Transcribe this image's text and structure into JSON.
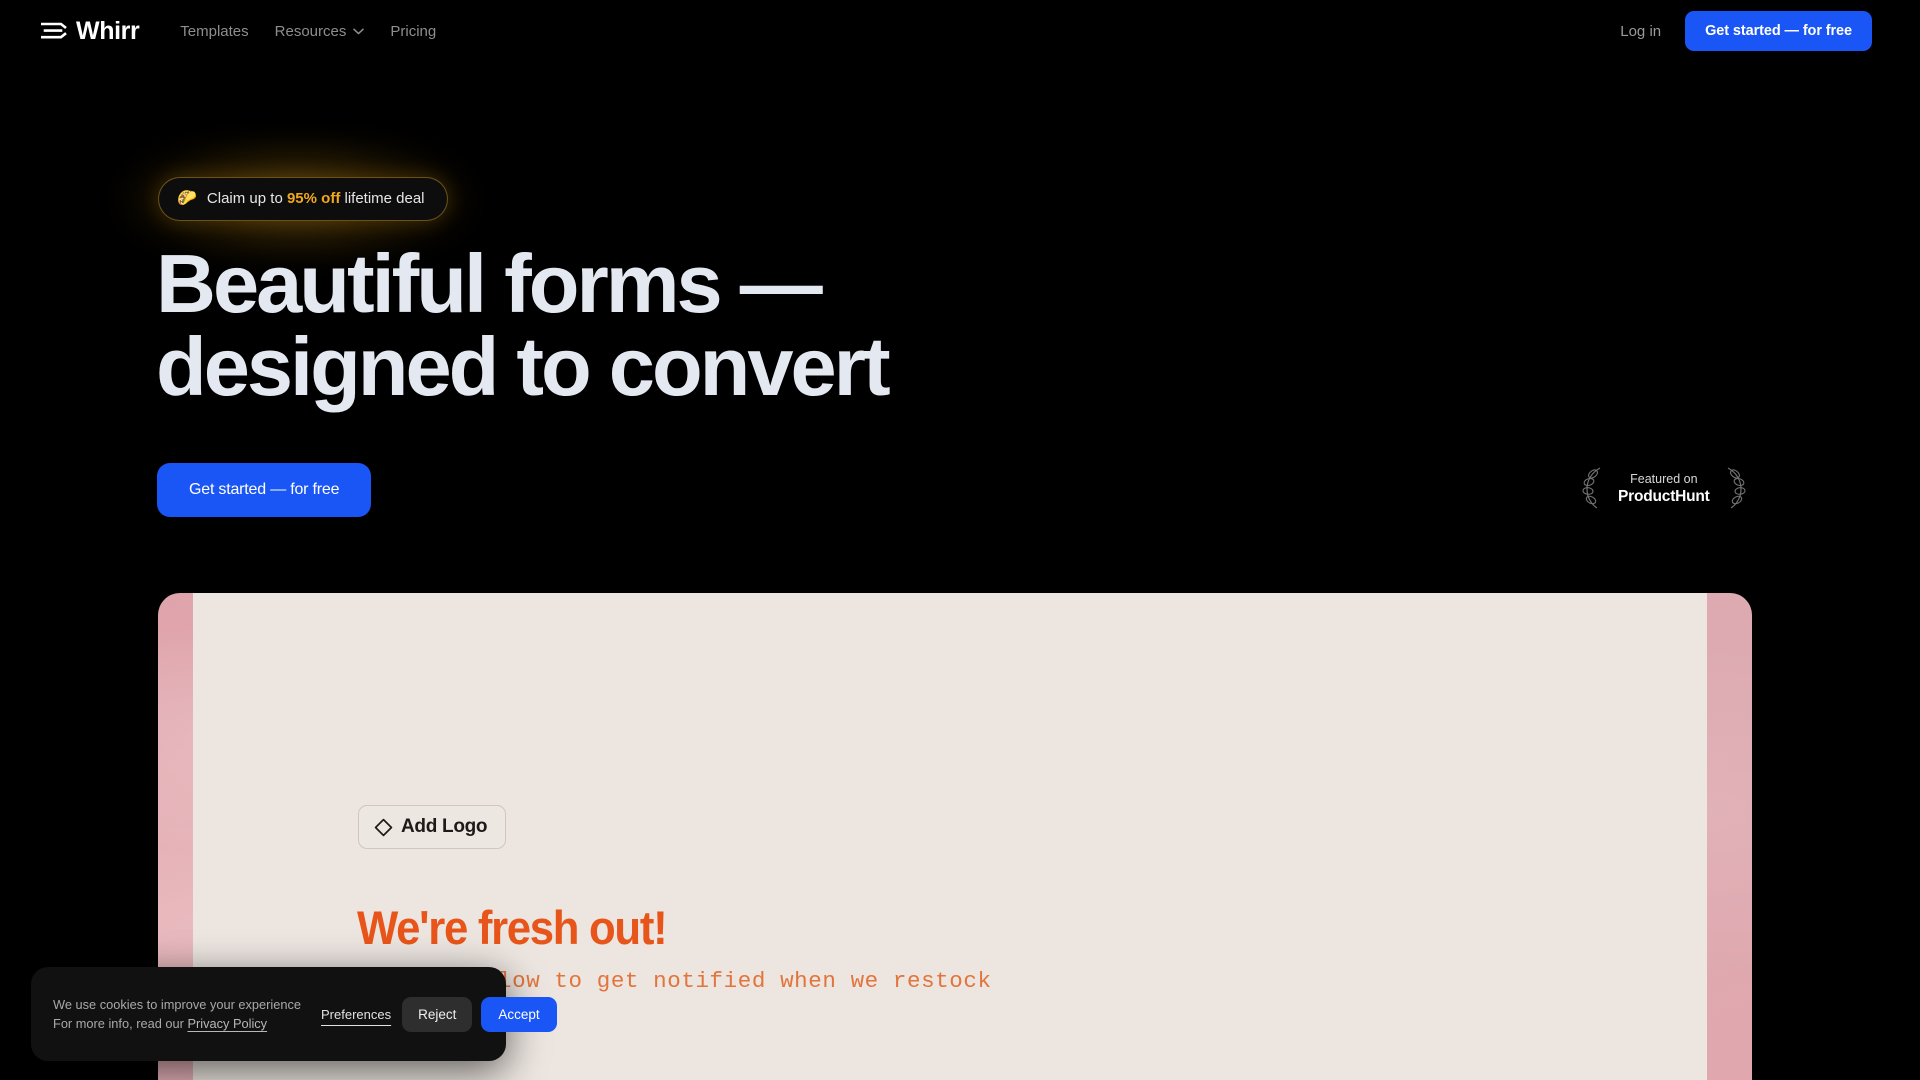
{
  "brand": {
    "name": "Whirr",
    "logo_icon": "whirr-wave-mark"
  },
  "nav": {
    "links": [
      {
        "label": "Templates",
        "has_dropdown": false
      },
      {
        "label": "Resources",
        "has_dropdown": true
      },
      {
        "label": "Pricing",
        "has_dropdown": false
      }
    ],
    "login_label": "Log in",
    "cta_label": "Get started — for free"
  },
  "hero": {
    "promo": {
      "emoji": "🌮",
      "text_before": "Claim up to ",
      "accent": "95% off",
      "text_after": " lifetime deal"
    },
    "headline": "Beautiful forms —\ndesigned to convert",
    "cta_label": "Get started — for free",
    "producthunt": {
      "featured_label": "Featured on",
      "name": "ProductHunt",
      "left_icon": "laurel-wreath-left-icon",
      "right_icon": "laurel-wreath-right-icon"
    }
  },
  "preview": {
    "add_logo_label": "Add Logo",
    "add_logo_icon": "diamond-icon",
    "form_title": "We're fresh out!",
    "form_subtitle": "Sign up below to get notified when we restock"
  },
  "cookie_banner": {
    "line1": "We use cookies to improve your experience",
    "line2_prefix": "For more info, read our ",
    "privacy_link": "Privacy Policy",
    "preferences_label": "Preferences",
    "reject_label": "Reject",
    "accept_label": "Accept"
  },
  "colors": {
    "background": "#000000",
    "accent_blue": "#1a56f5",
    "promo_gold": "#f0a91c",
    "form_orange": "#e8551a",
    "form_subtitle_orange": "#e2743c",
    "card_cream": "#ece5e0",
    "card_pink": "#dfa3ab",
    "headline": "#e4e8f0"
  }
}
